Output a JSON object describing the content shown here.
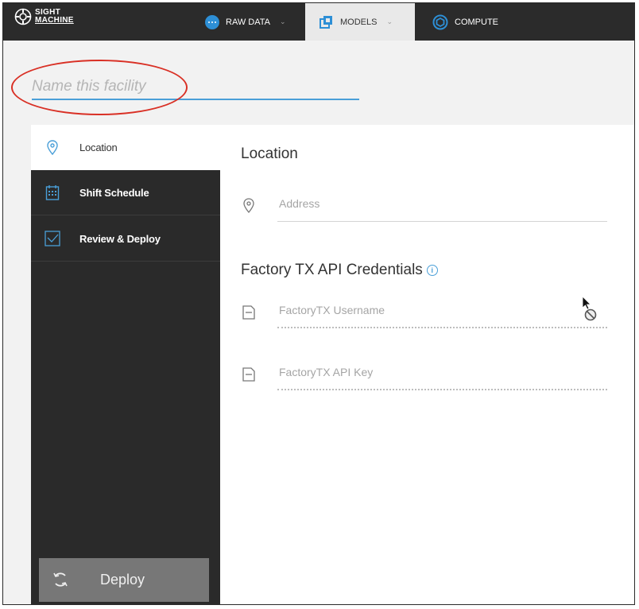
{
  "brand": {
    "line1": "SIGHT",
    "line2": "MACHINE"
  },
  "nav": {
    "tabs": [
      {
        "label": "RAW DATA",
        "icon": "raw-data-icon",
        "has_dropdown": true
      },
      {
        "label": "MODELS",
        "icon": "models-icon",
        "has_dropdown": true,
        "active": true
      },
      {
        "label": "COMPUTE",
        "icon": "compute-icon",
        "has_dropdown": false
      }
    ]
  },
  "facility": {
    "name_placeholder": "Name this facility",
    "name_value": ""
  },
  "sidebar": {
    "items": [
      {
        "label": "Location",
        "icon": "map-pin-icon",
        "active": true
      },
      {
        "label": "Shift Schedule",
        "icon": "calendar-icon",
        "active": false
      },
      {
        "label": "Review & Deploy",
        "icon": "checkbox-icon",
        "active": false
      }
    ],
    "deploy_label": "Deploy"
  },
  "main": {
    "location_title": "Location",
    "address_placeholder": "Address",
    "credentials_title": "Factory TX API Credentials",
    "username_placeholder": "FactoryTX Username",
    "api_key_placeholder": "FactoryTX API Key"
  },
  "colors": {
    "accent": "#4a9fd8",
    "nav_bg": "#2b2b2b",
    "sidebar_bg": "#2a2a2a",
    "annotation": "#d93025"
  }
}
